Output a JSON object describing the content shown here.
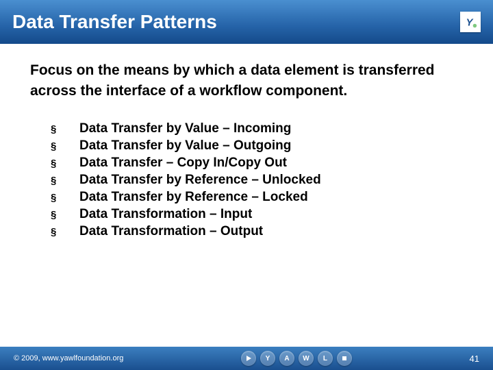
{
  "header": {
    "title": "Data Transfer Patterns",
    "logo_letter": "Y"
  },
  "intro": "Focus on the means by which a data element is transferred across the interface of a workflow component.",
  "bullets": [
    "Data Transfer by Value – Incoming",
    "Data Transfer by Value – Outgoing",
    "Data Transfer – Copy In/Copy Out",
    "Data Transfer by Reference – Unlocked",
    "Data Transfer by Reference – Locked",
    "Data Transformation – Input",
    "Data Transformation – Output"
  ],
  "bullet_marker": "§",
  "footer": {
    "copyright": "© 2009, www.yawlfoundation.org",
    "circles": [
      "play",
      "Y",
      "A",
      "W",
      "L",
      "stop"
    ],
    "page": "41"
  }
}
